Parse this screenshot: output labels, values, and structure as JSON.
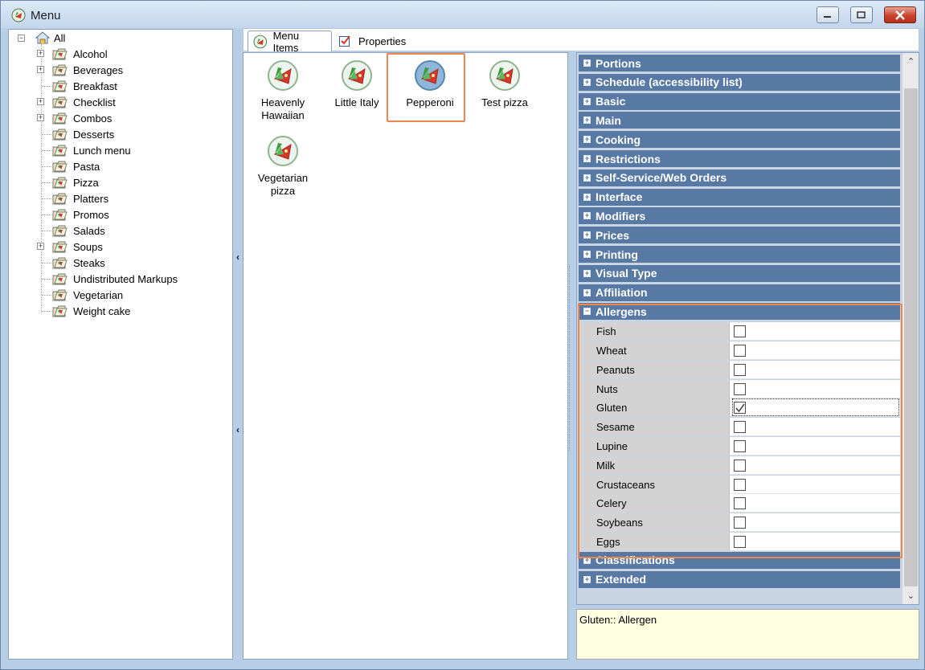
{
  "window": {
    "title": "Menu",
    "buttons": [
      "minimize",
      "maximize",
      "close"
    ]
  },
  "tree": {
    "root": "All",
    "items": [
      {
        "label": "Alcohol",
        "expandable": true
      },
      {
        "label": "Beverages",
        "expandable": true
      },
      {
        "label": "Breakfast",
        "expandable": false
      },
      {
        "label": "Checklist",
        "expandable": true
      },
      {
        "label": "Combos",
        "expandable": true
      },
      {
        "label": "Desserts",
        "expandable": false
      },
      {
        "label": "Lunch menu",
        "expandable": false
      },
      {
        "label": "Pasta",
        "expandable": false
      },
      {
        "label": "Pizza",
        "expandable": false
      },
      {
        "label": "Platters",
        "expandable": false
      },
      {
        "label": "Promos",
        "expandable": false
      },
      {
        "label": "Salads",
        "expandable": false
      },
      {
        "label": "Soups",
        "expandable": true
      },
      {
        "label": "Steaks",
        "expandable": false
      },
      {
        "label": "Undistributed Markups",
        "expandable": false
      },
      {
        "label": "Vegetarian",
        "expandable": false
      },
      {
        "label": "Weight cake",
        "expandable": false
      }
    ]
  },
  "tabs": [
    {
      "label": "Menu Items",
      "active": true
    },
    {
      "label": "Properties",
      "active": false
    }
  ],
  "menu_items": [
    {
      "label": "Heavenly Hawaiian"
    },
    {
      "label": "Little Italy"
    },
    {
      "label": "Pepperoni",
      "selected": true
    },
    {
      "label": "Test pizza"
    },
    {
      "label": "Vegetarian pizza"
    }
  ],
  "property_grid": {
    "categories_top": [
      "Portions",
      "Schedule (accessibility list)",
      "Basic",
      "Main",
      "Cooking",
      "Restrictions",
      "Self-Service/Web Orders",
      "Interface",
      "Modifiers",
      "Prices",
      "Printing",
      "Visual Type",
      "Affiliation"
    ],
    "expanded_category": "Allergens",
    "allergens": [
      {
        "name": "Fish",
        "checked": false
      },
      {
        "name": "Wheat",
        "checked": false
      },
      {
        "name": "Peanuts",
        "checked": false
      },
      {
        "name": "Nuts",
        "checked": false
      },
      {
        "name": "Gluten",
        "checked": true
      },
      {
        "name": "Sesame",
        "checked": false
      },
      {
        "name": "Lupine",
        "checked": false
      },
      {
        "name": "Milk",
        "checked": false
      },
      {
        "name": "Crustaceans",
        "checked": false
      },
      {
        "name": "Celery",
        "checked": false
      },
      {
        "name": "Soybeans",
        "checked": false
      },
      {
        "name": "Eggs",
        "checked": false
      }
    ],
    "categories_bottom": [
      "Classifications",
      "Extended"
    ]
  },
  "description": "Gluten:: Allergen",
  "colors": {
    "category_bg": "#5879a3",
    "highlight": "#f0884e",
    "description_bg": "#ffffe1"
  }
}
